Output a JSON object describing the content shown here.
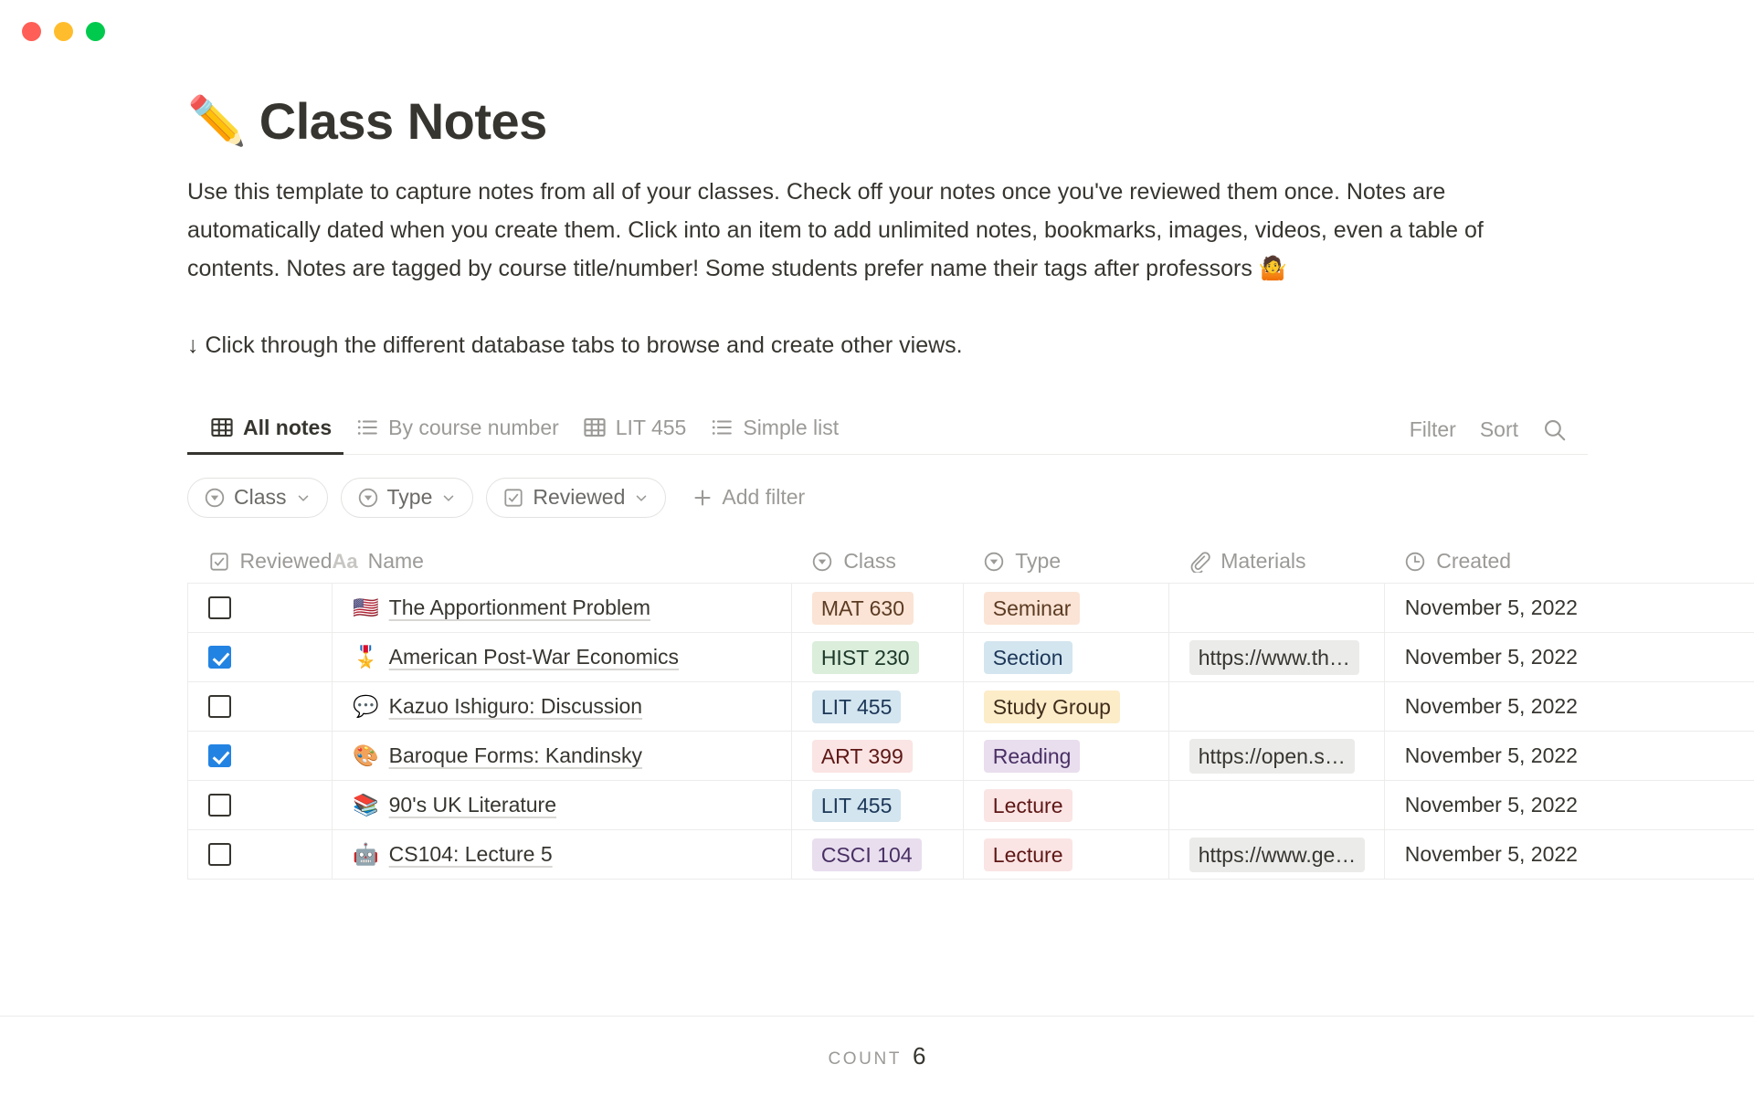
{
  "window": {
    "traffic_lights": [
      {
        "name": "close",
        "color": "#ff5f57"
      },
      {
        "name": "minimize",
        "color": "#ffbd2e"
      },
      {
        "name": "maximize",
        "color": "#00ca4e"
      }
    ]
  },
  "page": {
    "emoji": "✏️",
    "title": "Class Notes",
    "intro": "Use this template to capture notes from all of your classes. Check off your notes once you've reviewed them once. Notes are automatically dated when you create them. Click into an item to add unlimited notes, bookmarks, images, videos, even a table of contents. Notes are tagged by course title/number!  Some students prefer name their tags after professors 🤷",
    "callout": "↓ Click through the different database tabs to browse and create other views."
  },
  "database": {
    "tabs": [
      {
        "label": "All notes",
        "icon": "table-icon",
        "active": true
      },
      {
        "label": "By course number",
        "icon": "list-icon",
        "active": false
      },
      {
        "label": "LIT 455",
        "icon": "table-icon",
        "active": false
      },
      {
        "label": "Simple list",
        "icon": "list-icon",
        "active": false
      }
    ],
    "tools": [
      {
        "label": "Filter",
        "name": "filter-button"
      },
      {
        "label": "Sort",
        "name": "sort-button"
      }
    ],
    "search_icon": "search-icon",
    "filters": [
      {
        "label": "Class",
        "icon": "select-icon"
      },
      {
        "label": "Type",
        "icon": "select-icon"
      },
      {
        "label": "Reviewed",
        "icon": "checkbox-icon"
      }
    ],
    "add_filter_label": "Add filter",
    "columns": [
      {
        "key": "reviewed",
        "label": "Reviewed",
        "icon": "checkbox-icon"
      },
      {
        "key": "name",
        "label": "Name",
        "icon": "title-icon"
      },
      {
        "key": "class",
        "label": "Class",
        "icon": "select-icon"
      },
      {
        "key": "type",
        "label": "Type",
        "icon": "select-icon"
      },
      {
        "key": "materials",
        "label": "Materials",
        "icon": "paperclip-icon"
      },
      {
        "key": "created",
        "label": "Created",
        "icon": "clock-icon"
      }
    ],
    "rows": [
      {
        "reviewed": false,
        "emoji": "🇺🇸",
        "name": "The Apportionment Problem",
        "class": "MAT 630",
        "class_bg": "#fbe4d5",
        "class_fg": "#5c3b23",
        "type": "Seminar",
        "type_bg": "#fbe4d5",
        "type_fg": "#5c3b23",
        "materials": "",
        "created": "November 5, 2022"
      },
      {
        "reviewed": true,
        "emoji": "🎖️",
        "name": "American Post-War Economics",
        "class": "HIST 230",
        "class_bg": "#dbeddb",
        "class_fg": "#1c3829",
        "type": "Section",
        "type_bg": "#d3e5ef",
        "type_fg": "#1c3758",
        "materials": "https://www.th…",
        "created": "November 5, 2022"
      },
      {
        "reviewed": false,
        "emoji": "💬",
        "name": "Kazuo Ishiguro: Discussion",
        "class": "LIT 455",
        "class_bg": "#d3e5ef",
        "class_fg": "#1c3758",
        "type": "Study Group",
        "type_bg": "#fdecc8",
        "type_fg": "#402c1b",
        "materials": "",
        "created": "November 5, 2022"
      },
      {
        "reviewed": true,
        "emoji": "🎨",
        "name": "Baroque Forms: Kandinsky",
        "class": "ART 399",
        "class_bg": "#fbe4e4",
        "class_fg": "#5d1715",
        "type": "Reading",
        "type_bg": "#e8deee",
        "type_fg": "#492f64",
        "materials": "https://open.s…",
        "created": "November 5, 2022"
      },
      {
        "reviewed": false,
        "emoji": "📚",
        "name": "90's UK Literature",
        "class": "LIT 455",
        "class_bg": "#d3e5ef",
        "class_fg": "#1c3758",
        "type": "Lecture",
        "type_bg": "#fbe4e4",
        "type_fg": "#5d1715",
        "materials": "",
        "created": "November 5, 2022"
      },
      {
        "reviewed": false,
        "emoji": "🤖",
        "name": "CS104: Lecture 5",
        "class": "CSCI 104",
        "class_bg": "#e8deee",
        "class_fg": "#492f64",
        "type": "Lecture",
        "type_bg": "#fbe4e4",
        "type_fg": "#5d1715",
        "materials": "https://www.ge…",
        "created": "November 5, 2022"
      }
    ]
  },
  "footer": {
    "count_label": "Count",
    "count_value": "6"
  }
}
